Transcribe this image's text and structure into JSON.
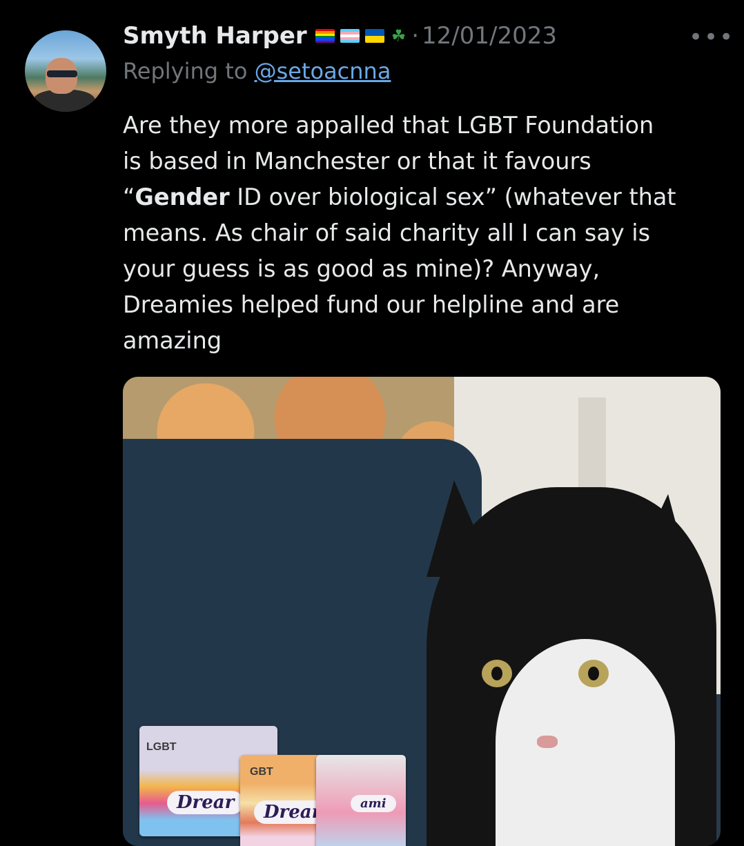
{
  "tweet": {
    "author": "Smyth Harper",
    "author_flags": [
      "rainbow-flag-icon",
      "trans-flag-icon",
      "ukraine-flag-icon",
      "shamrock-icon"
    ],
    "date_separator": "·",
    "date": "12/01/2023",
    "more_label": "•••",
    "replying_prefix": "Replying to",
    "replying_handle": "@setoacnna",
    "text_lines": [
      {
        "plain": "Are they more appalled that LGBT Foundation"
      },
      {
        "plain": "is based in Manchester or that it favours"
      },
      {
        "before": "“",
        "bold": "Gender",
        "after": " ID over biological sex” (whatever that"
      },
      {
        "plain": "means. As chair of said charity all I can say is"
      },
      {
        "plain": "your guess is as good as mine)? Anyway,"
      },
      {
        "plain": "Dreamies helped fund our helpline and are"
      },
      {
        "plain": "amazing"
      }
    ]
  },
  "media": {
    "packets": [
      {
        "label": "Drear",
        "brand": "LGBT"
      },
      {
        "label": "Dreamies",
        "brand": "GBT"
      },
      {
        "label": "ami",
        "brand": ""
      }
    ]
  },
  "colors": {
    "background": "#000000",
    "text": "#e7e9ea",
    "muted": "#71767b",
    "link": "#6aa8e6"
  }
}
